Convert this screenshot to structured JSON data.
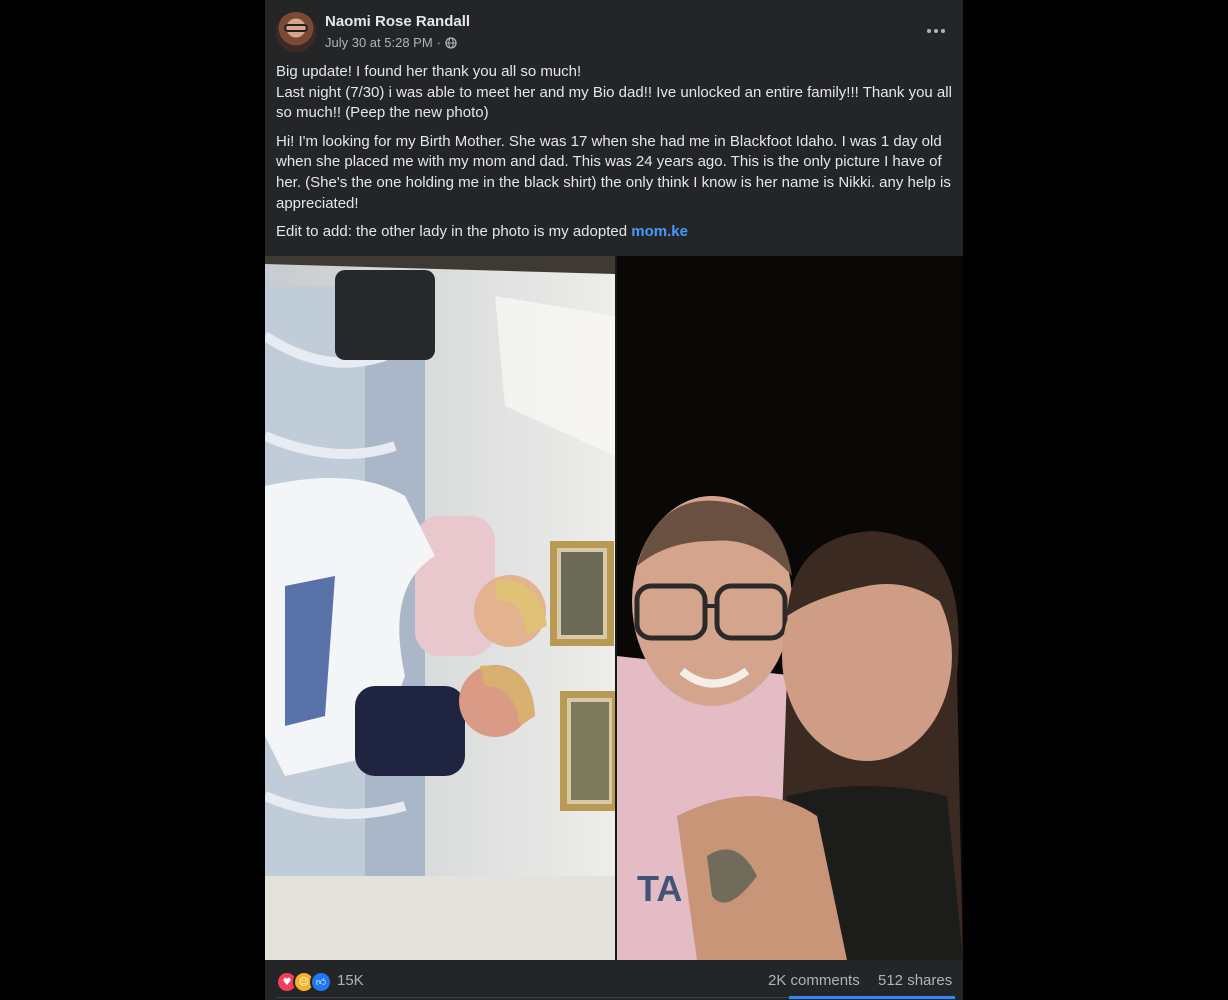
{
  "post": {
    "author": "Naomi Rose Randall",
    "timestamp": "July 30 at 5:28 PM",
    "separator": "·",
    "privacy_icon": "globe-icon",
    "more_icon": "more-horizontal-icon",
    "paragraphs": [
      "Big update! I found her thank you all so much!\nLast night (7/30) i was able to meet her and my Bio dad!! Ive unlocked an entire family!!! Thank you all so much!! (Peep the new photo)",
      "Hi! I'm looking for my Birth Mother. She was 17 when she had me in Blackfoot Idaho. I was 1 day old when she placed me with my mom and dad. This was 24 years ago. This is the only picture I have of her. (She's the one holding me in the black shirt) the only think I know is her name is Nikki. any help is appreciated!"
    ],
    "edit_prefix": "Edit to add: the other lady in the photo is my adopted ",
    "edit_link": "mom.ke"
  },
  "reactions": {
    "icons": [
      "heart-reaction-icon",
      "care-reaction-icon",
      "like-reaction-icon"
    ],
    "count": "15K",
    "comments": "2K comments",
    "shares": "512 shares"
  },
  "colors": {
    "background": "#242526",
    "text": "#e4e6eb",
    "secondary": "#b0b3b8",
    "link": "#4599ff",
    "love": "#f33e58",
    "care": "#f7b125",
    "like": "#2078f4"
  }
}
